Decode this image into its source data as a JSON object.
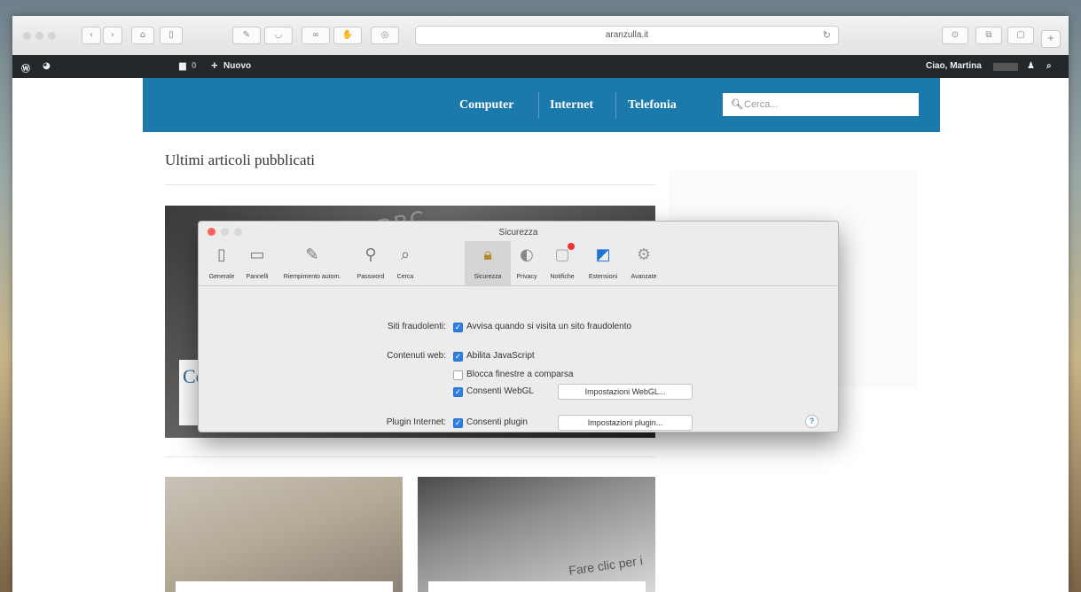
{
  "browser": {
    "url": "aranzulla.it",
    "toolbar_icons": [
      "back-icon",
      "forward-icon",
      "home-icon",
      "sidebar-icon",
      "edit-icon",
      "pocket-icon",
      "link-icon",
      "hand-icon",
      "share-icon",
      "reload-icon",
      "download-icon",
      "tabs-icon",
      "new-tab-icon"
    ]
  },
  "adminbar": {
    "comments_count": "0",
    "new_label": "Nuovo",
    "greeting": "Ciao, Martina"
  },
  "site": {
    "nav": [
      "Computer",
      "Internet",
      "Telefonia"
    ],
    "search_placeholder": "Cerca...",
    "latest_heading": "Ultimi articoli pubblicati",
    "featured_bg_text": "BBC",
    "featured_title_fragment": "Co de",
    "thumb2_text": "Fare clic per i"
  },
  "prefs": {
    "title": "Sicurezza",
    "tabs": [
      {
        "label": "Generale",
        "icon": "general-icon"
      },
      {
        "label": "Pannelli",
        "icon": "tabs-panel-icon"
      },
      {
        "label": "Riempimento autom.",
        "icon": "autofill-icon"
      },
      {
        "label": "Password",
        "icon": "key-icon"
      },
      {
        "label": "Cerca",
        "icon": "magnifier-icon"
      },
      {
        "label": "Sicurezza",
        "icon": "lock-icon"
      },
      {
        "label": "Privacy",
        "icon": "privacy-icon"
      },
      {
        "label": "Notifiche",
        "icon": "notifications-icon"
      },
      {
        "label": "Estensioni",
        "icon": "extensions-icon"
      },
      {
        "label": "Avanzate",
        "icon": "gear-icon"
      }
    ],
    "selected_tab": "Sicurezza",
    "fraud_label": "Siti fraudolenti:",
    "fraud_option": "Avvisa quando si visita un sito fraudolento",
    "web_label": "Contenuti web:",
    "js_option": "Abilita JavaScript",
    "popup_option": "Blocca finestre a comparsa",
    "webgl_option": "Consenti WebGL",
    "webgl_button": "Impostazioni WebGL...",
    "plugin_label": "Plugin Internet:",
    "plugin_option": "Consenti plugin",
    "plugin_button": "Impostazioni plugin...",
    "help": "?"
  },
  "colors": {
    "site_header": "#1c79ac",
    "admin_bar": "#23282d",
    "checkbox_on": "#2f7fe3",
    "close_button": "#fc605c"
  }
}
